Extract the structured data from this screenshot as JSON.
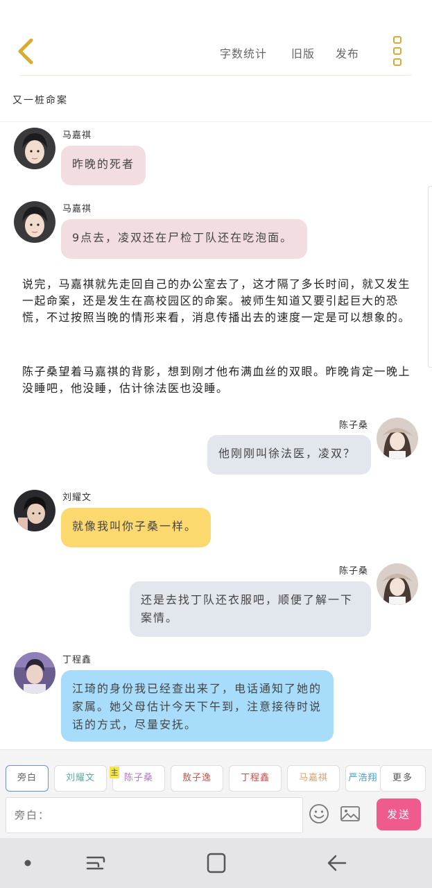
{
  "header": {
    "actions": [
      "字数统计",
      "旧版",
      "发布"
    ]
  },
  "chapter": {
    "title": "又一桩命案"
  },
  "messages": [
    {
      "type": "left",
      "speaker": "马嘉祺",
      "text": "昨晚的死者"
    },
    {
      "type": "left",
      "speaker": "马嘉祺",
      "text": "9点去，凌双还在尸检丁队还在吃泡面。"
    },
    {
      "type": "narration",
      "text": "说完，马嘉祺就先走回自己的办公室去了，这才隔了多长时间，就又发生一起命案，还是发生在高校园区的命案。被师生知道又要引起巨大的恐慌，不过按照当晚的情形来看，消息传播出去的速度一定是可以想象的。"
    },
    {
      "type": "narration",
      "text": "陈子桑望着马嘉祺的背影，想到刚才他布满血丝的双眼。昨晚肯定一晚上没睡吧，他没睡，估计徐法医也没睡。"
    },
    {
      "type": "right",
      "speaker": "陈子桑",
      "text": "他刚刚叫徐法医，凌双？"
    },
    {
      "type": "left",
      "speaker": "刘耀文",
      "text": "就像我叫你子桑一样。"
    },
    {
      "type": "right",
      "speaker": "陈子桑",
      "text": "还是去找丁队还衣服吧，顺便了解一下案情。"
    },
    {
      "type": "left",
      "speaker": "丁程鑫",
      "text": "江琦的身份我已经查出来了，电话通知了她的家属。她父母估计今天下午到，注意接待时说话的方式，尽量安抚。"
    }
  ],
  "characters": [
    {
      "label": "旁白",
      "color": "#666666"
    },
    {
      "label": "刘耀文",
      "color": "#5fa8a0"
    },
    {
      "label": "陈子桑",
      "color": "#b27bc6"
    },
    {
      "label": "敖子逸",
      "color": "#d0504a"
    },
    {
      "label": "丁程鑫",
      "color": "#d44848"
    },
    {
      "label": "马嘉祺",
      "color": "#e0a070"
    },
    {
      "label": "严浩翔",
      "color": "#4aa0c8"
    }
  ],
  "host_badge": "主",
  "more_label": "更多",
  "input": {
    "placeholder": "旁白："
  },
  "send_label": "发送",
  "icons": {
    "back": "chevron-left-icon",
    "menu": "more-vertical-icon",
    "emoji": "smiley-icon",
    "image": "image-icon"
  },
  "colors": {
    "accent": "#d6ad2e",
    "bubble_ma": "#f2dde0",
    "bubble_chen": "#e2e6ed",
    "bubble_liu": "#fbd96e",
    "bubble_ding": "#a7dcfb",
    "send": "#ef5b8d"
  }
}
